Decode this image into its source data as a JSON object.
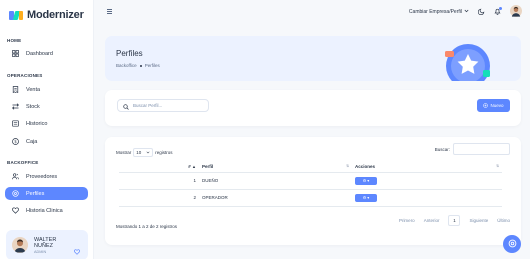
{
  "app": {
    "title": "Modernizer"
  },
  "sidebar": {
    "sections": [
      {
        "title": "HOME",
        "items": [
          {
            "label": "Dashboard",
            "icon": "dashboard-icon"
          }
        ]
      },
      {
        "title": "OPERACIONES",
        "items": [
          {
            "label": "Venta",
            "icon": "receipt-icon"
          },
          {
            "label": "Stock",
            "icon": "arrows-icon"
          },
          {
            "label": "Historico",
            "icon": "list-icon"
          },
          {
            "label": "Caja",
            "icon": "dollar-circle-icon"
          }
        ]
      },
      {
        "title": "BACKOFFICE",
        "items": [
          {
            "label": "Proveedores",
            "icon": "users-icon"
          },
          {
            "label": "Perfiles",
            "icon": "settings-icon",
            "active": true
          },
          {
            "label": "Historia Clinica",
            "icon": "heart-handshake-icon"
          }
        ]
      }
    ],
    "user": {
      "name_line1": "WALTER",
      "name_line2": "NUÑEZ",
      "role": "ADMIN"
    }
  },
  "topbar": {
    "company_label": "Cambiar Empresa/Perfil"
  },
  "page": {
    "title": "Perfiles",
    "breadcrumb": [
      "Backoffice",
      "Perfiles"
    ]
  },
  "search": {
    "placeholder": "Buscar Perfil..."
  },
  "new_button": {
    "label": "Nuevo"
  },
  "table_controls": {
    "show_label": "Mostrar",
    "entries_value": "10",
    "entries_label": "registros",
    "search_label": "Buscar:"
  },
  "table": {
    "headers": {
      "num": "#",
      "perfil": "Perfil",
      "acciones": "Acciones"
    },
    "rows": [
      {
        "num": "1",
        "perfil": "DUEÑO"
      },
      {
        "num": "2",
        "perfil": "OPERADOR"
      }
    ]
  },
  "footer": {
    "info": "Mostrando 1 a 2 de 2 registros",
    "first": "Primero",
    "prev": "Anterior",
    "current": "1",
    "next": "Siguiente",
    "last": "Último"
  },
  "colors": {
    "primary": "#5d87ff",
    "banner_bg": "#ecf2ff",
    "text": "#2a3547"
  }
}
